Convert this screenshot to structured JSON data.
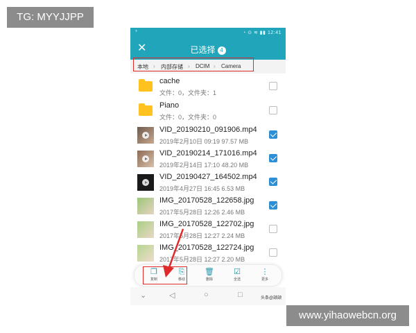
{
  "watermarks": {
    "top_left": "TG: MYYJJPP",
    "bottom_right": "www.yihaowebcn.org",
    "app_corner": "头条@颉颉"
  },
  "status_bar": {
    "left_icon": "android-icon",
    "time": "12:41"
  },
  "header": {
    "title": "已选择",
    "count": "4"
  },
  "breadcrumb": [
    "本地",
    "内部存储",
    "DCIM",
    "Camera"
  ],
  "files": [
    {
      "name": "cache",
      "meta": "文件：0，文件夹：1",
      "type": "folder",
      "checked": false
    },
    {
      "name": "Piano",
      "meta": "文件：0，文件夹：0",
      "type": "folder",
      "checked": false
    },
    {
      "name": "VID_20190210_091906.mp4",
      "meta": "2019年2月10日 09:19 97.57 MB",
      "type": "video",
      "checked": true
    },
    {
      "name": "VID_20190214_171016.mp4",
      "meta": "2019年2月14日 17:10 48.20 MB",
      "type": "video",
      "checked": true
    },
    {
      "name": "VID_20190427_164502.mp4",
      "meta": "2019年4月27日 16:45 6.53 MB",
      "type": "video",
      "checked": true
    },
    {
      "name": "IMG_20170528_122658.jpg",
      "meta": "2017年5月28日 12:26 2.46 MB",
      "type": "image",
      "checked": true
    },
    {
      "name": "IMG_20170528_122702.jpg",
      "meta": "2017年5月28日 12:27 2.24 MB",
      "type": "image",
      "checked": false
    },
    {
      "name": "IMG_20170528_122724.jpg",
      "meta": "2017年5月28日 12:27 2.20 MB",
      "type": "image",
      "checked": false
    }
  ],
  "toolbar": [
    {
      "label": "复制",
      "icon": "copy-icon"
    },
    {
      "label": "移动",
      "icon": "move-icon"
    },
    {
      "label": "删除",
      "icon": "trash-icon"
    },
    {
      "label": "全选",
      "icon": "select-all-icon"
    },
    {
      "label": "更多",
      "icon": "more-icon"
    }
  ],
  "colors": {
    "accent": "#20a5bb",
    "check": "#2d8fd5",
    "folder": "#ffc21f",
    "highlight": "#e02a2a"
  }
}
